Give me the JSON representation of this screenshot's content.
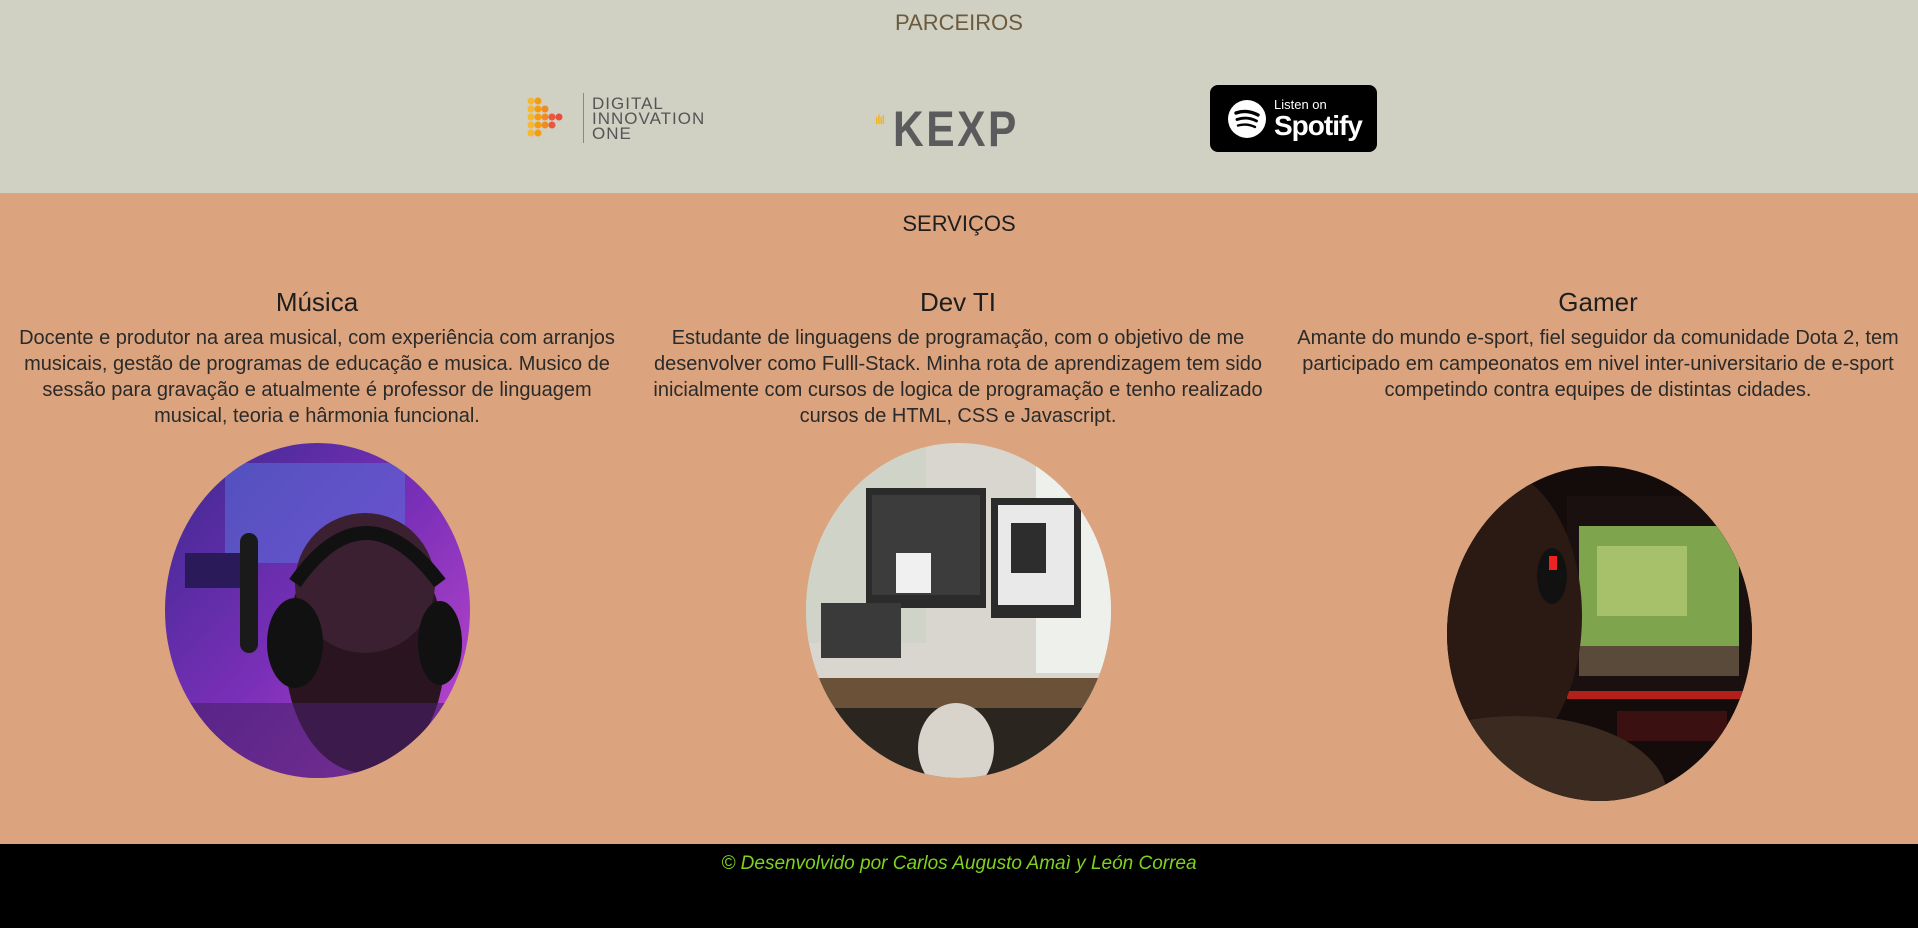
{
  "partners": {
    "title": "PARCEIROS",
    "dio": {
      "line1": "DIGITAL",
      "line2": "INNOVATION",
      "line3": "ONE"
    },
    "kexp": {
      "text": "KEXP"
    },
    "spotify": {
      "small": "Listen on",
      "big": "Spotify"
    }
  },
  "services": {
    "title": "SERVIÇOS",
    "items": [
      {
        "title": "Música",
        "text": "Docente e produtor na area musical, com experiência com arranjos musicais, gestão de programas de educação e musica. Musico de sessão para gravação e atualmente é professor de linguagem musical, teoria e hârmonia funcional."
      },
      {
        "title": "Dev TI",
        "text": "Estudante de linguagens de programação, com o objetivo de me desenvolver como Fulll-Stack. Minha rota de aprendizagem tem sido inicialmente com cursos de logica de programação e tenho realizado cursos de HTML, CSS e Javascript."
      },
      {
        "title": "Gamer",
        "text": "Amante do mundo e-sport, fiel seguidor da comunidade Dota 2, tem participado em campeonatos em nivel inter-universitario de e-sport competindo contra equipes de distintas cidades."
      }
    ]
  },
  "footer": {
    "text": "© Desenvolvido por Carlos Augusto Amaì y León Correa"
  },
  "colors": {
    "partners_bg": "#d0d1c3",
    "services_bg": "#dba47e",
    "footer_bg": "#000000",
    "footer_text": "#7ed321"
  }
}
